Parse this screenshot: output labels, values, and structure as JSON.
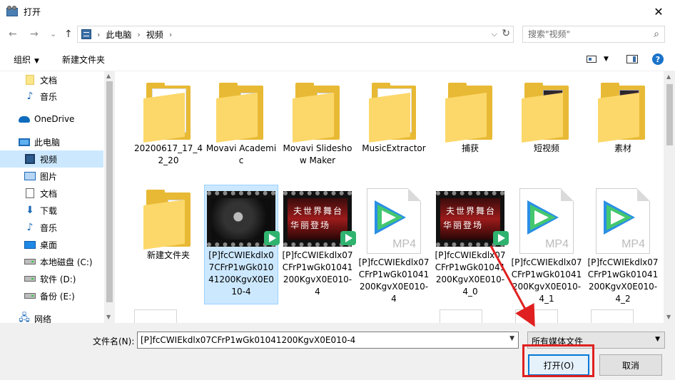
{
  "window": {
    "title": "打开",
    "close": "✕"
  },
  "nav": {
    "back": "←",
    "forward": "→",
    "recent": "⌄",
    "up": "↑"
  },
  "address": {
    "crumbs": [
      "此电脑",
      "视频"
    ],
    "separator": "›",
    "dropdown": "⌵",
    "refresh": "↻"
  },
  "search": {
    "placeholder": "搜索\"视频\"",
    "icon": "⌕"
  },
  "toolbar": {
    "organize": "组织",
    "organize_caret": "▼",
    "new_folder": "新建文件夹",
    "help": "?",
    "view_caret": "▼"
  },
  "sidebar": {
    "items": [
      {
        "label": "文档",
        "icon": "folder-yellow"
      },
      {
        "label": "音乐",
        "icon": "music-note"
      },
      {
        "label": "OneDrive",
        "icon": "cloud"
      },
      {
        "label": "此电脑",
        "icon": "computer"
      },
      {
        "label": "视频",
        "icon": "video",
        "selected": true
      },
      {
        "label": "图片",
        "icon": "picture"
      },
      {
        "label": "文档",
        "icon": "document"
      },
      {
        "label": "下载",
        "icon": "download-arrow"
      },
      {
        "label": "音乐",
        "icon": "music-note"
      },
      {
        "label": "桌面",
        "icon": "desktop"
      },
      {
        "label": "本地磁盘 (C:)",
        "icon": "drive"
      },
      {
        "label": "软件 (D:)",
        "icon": "drive"
      },
      {
        "label": "备份 (E:)",
        "icon": "drive"
      },
      {
        "label": "网络",
        "icon": "network"
      }
    ]
  },
  "files": {
    "row1": [
      {
        "name": "20200617_17_42_20",
        "type": "folder"
      },
      {
        "name": "Movavi Academic",
        "type": "folder-doc"
      },
      {
        "name": "Movavi Slideshow Maker",
        "type": "folder-doc"
      },
      {
        "name": "MusicExtractor",
        "type": "folder"
      },
      {
        "name": "捕获",
        "type": "folder"
      },
      {
        "name": "短视频",
        "type": "folder-thumb"
      },
      {
        "name": "素材",
        "type": "folder-thumb"
      }
    ],
    "row2": [
      {
        "name": "新建文件夹",
        "type": "folder-doc"
      },
      {
        "name": "[P]fcCWIEkdlx07CFrP1wGk01041200KgvX0E010-4",
        "type": "video-smile",
        "selected": true
      },
      {
        "name": "[P]fcCWIEkdlx07CFrP1wGk01041200KgvX0E010-4",
        "type": "video-red",
        "overlay": [
          "夫世界舞台",
          "华丽登场"
        ]
      },
      {
        "name": "[P]fcCWIEkdlx07CFrP1wGk01041200KgvX0E010-4",
        "type": "mp4"
      },
      {
        "name": "[P]fcCWIEkdlx07CFrP1wGk01041200KgvX0E010-4_0",
        "type": "video-red",
        "overlay": [
          "夫世界舞台",
          "华丽登场"
        ]
      },
      {
        "name": "[P]fcCWIEkdlx07CFrP1wGk01041200KgvX0E010-4_1",
        "type": "mp4"
      },
      {
        "name": "[P]fcCWIEkdlx07CFrP1wGk01041200KgvX0E010-4_2",
        "type": "mp4"
      }
    ],
    "mp4_ext": "MP4"
  },
  "footer": {
    "filename_label": "文件名(N):",
    "filename_value": "[P]fcCWIEkdlx07CFrP1wGk01041200KgvX0E010-4",
    "filter_value": "所有媒体文件",
    "open_button": "打开(O)",
    "cancel_button": "取消",
    "dropdown": "▼"
  },
  "colors": {
    "selection": "#cce8ff",
    "annotation_red": "#e02020",
    "accent": "#0078d7"
  }
}
